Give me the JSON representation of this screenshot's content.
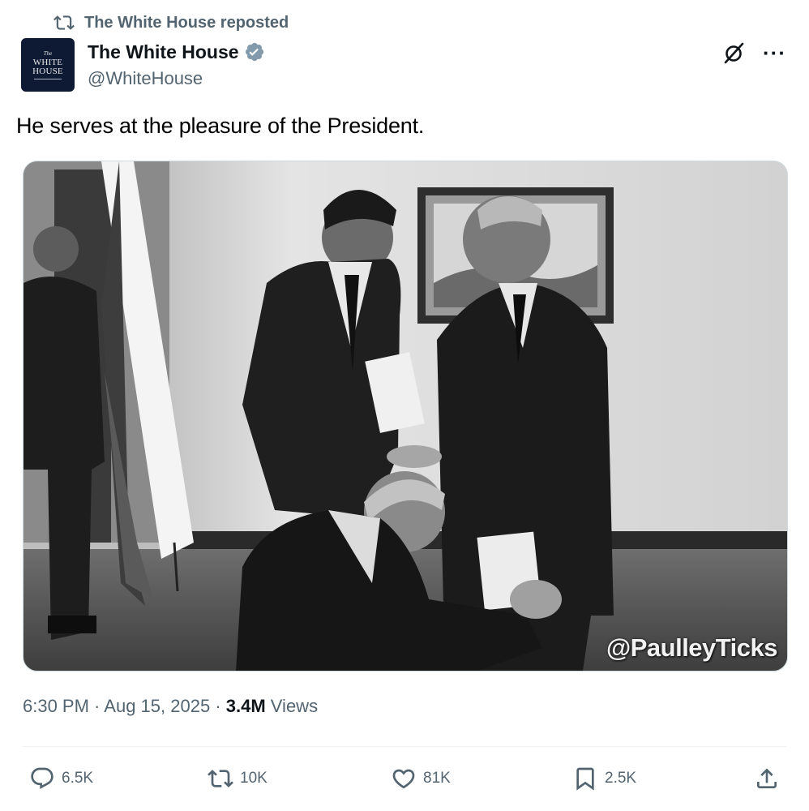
{
  "repost": {
    "text": "The White House reposted",
    "icon": "repost-icon"
  },
  "author": {
    "avatar_lines": [
      "The",
      "WHITE",
      "HOUSE"
    ],
    "name": "The White House",
    "handle": "@WhiteHouse",
    "verified_icon": "verified-badge-icon"
  },
  "top_actions": {
    "grok_icon": "grok-icon",
    "more_label": "···"
  },
  "tweet": {
    "text": "He serves at the pleasure of the President."
  },
  "media": {
    "watermark": "@PaulleyTicks",
    "style": "black-and-white photograph"
  },
  "meta": {
    "time": "6:30 PM",
    "sep1": " · ",
    "date": "Aug 15, 2025",
    "sep2": " · ",
    "views_count": "3.4M",
    "views_label": " Views"
  },
  "actions": {
    "reply": {
      "icon": "reply-icon",
      "count": "6.5K"
    },
    "repost": {
      "icon": "repost-icon",
      "count": "10K"
    },
    "like": {
      "icon": "heart-icon",
      "count": "81K"
    },
    "bookmark": {
      "icon": "bookmark-icon",
      "count": "2.5K"
    },
    "share": {
      "icon": "share-icon"
    }
  },
  "colors": {
    "secondary_text": "#536471",
    "primary_text": "#0f1419",
    "verified_badge": "#829aab",
    "divider": "#eff3f4"
  }
}
